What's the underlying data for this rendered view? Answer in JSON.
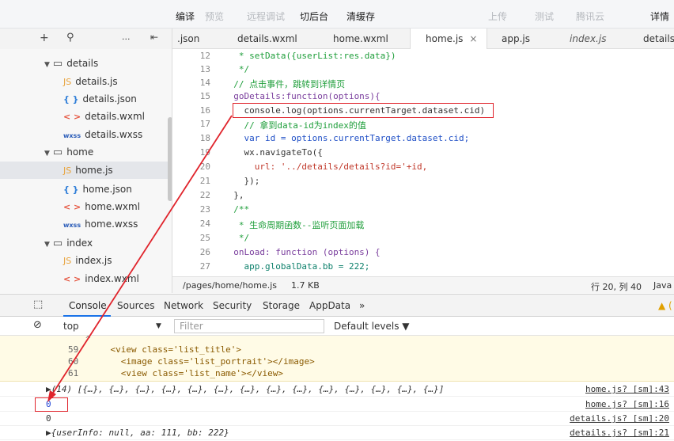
{
  "toolbar": {
    "compile": "编译",
    "preview": "预览",
    "remote_debug": "远程调试",
    "background": "切后台",
    "clear_cache": "清缓存",
    "upload": "上传",
    "test": "测试",
    "tencent_cloud": "腾讯云",
    "details": "详情"
  },
  "tabs": [
    {
      "label": ".json"
    },
    {
      "label": "details.wxml"
    },
    {
      "label": "home.wxml"
    },
    {
      "label": "home.js",
      "close": "×"
    },
    {
      "label": "app.js"
    },
    {
      "label": "index.js"
    },
    {
      "label": "details"
    }
  ],
  "side_tools": {
    "plus": "+",
    "search": "⚲",
    "more": "···",
    "collapse": "⇤"
  },
  "tree": [
    {
      "label": "details",
      "type": "folder"
    },
    {
      "label": "details.js",
      "type": "js",
      "badge": "JS"
    },
    {
      "label": "details.json",
      "type": "json",
      "badge": "{ }"
    },
    {
      "label": "details.wxml",
      "type": "wxml",
      "badge": "< >"
    },
    {
      "label": "details.wxss",
      "type": "wxss",
      "badge": "wxss"
    },
    {
      "label": "home",
      "type": "folder"
    },
    {
      "label": "home.js",
      "type": "js",
      "badge": "JS"
    },
    {
      "label": "home.json",
      "type": "json",
      "badge": "{ }"
    },
    {
      "label": "home.wxml",
      "type": "wxml",
      "badge": "< >"
    },
    {
      "label": "home.wxss",
      "type": "wxss",
      "badge": "wxss"
    },
    {
      "label": "index",
      "type": "folder"
    },
    {
      "label": "index.js",
      "type": "js",
      "badge": "JS"
    },
    {
      "label": "index.wxml",
      "type": "wxml",
      "badge": "< >"
    }
  ],
  "editor": {
    "line_numbers": [
      "12",
      "13",
      "14",
      "15",
      "16",
      "17",
      "18",
      "19",
      "20",
      "21",
      "22",
      "23",
      "24",
      "25",
      "26",
      "27"
    ],
    "lines": [
      "   * setData({userList:res.data})",
      "   */",
      "  // 点击事件，跳转到详情页",
      "  goDetails:function(options){",
      "    console.log(options.currentTarget.dataset.cid)",
      "    // 拿到data-id为index的值",
      "    var id = options.currentTarget.dataset.cid;",
      "    wx.navigateTo({",
      "      url: '../details/details?id='+id,",
      "    });",
      "  },",
      "  /**",
      "   * 生命周期函数--监听页面加载",
      "   */",
      "  onLoad: function (options) {",
      "    app.globalData.bb = 222;"
    ]
  },
  "status": {
    "path": "/pages/home/home.js",
    "size": "1.7 KB",
    "cursor": "行 20, 列 40",
    "lang": "Java"
  },
  "devtools": {
    "tabs": [
      "Console",
      "Sources",
      "Network",
      "Security",
      "Storage",
      "AppData",
      "»"
    ],
    "warn_badge": "▲ (",
    "context": "top",
    "filter_placeholder": "Filter",
    "levels": "Default levels ▼"
  },
  "console": {
    "snippet": [
      {
        "num": "59",
        "code": "    <view class='list_title'>"
      },
      {
        "num": "60",
        "code": "      <image class='list_portrait'></image>"
      },
      {
        "num": "61",
        "code": "      <view class='list_name'></view>"
      }
    ],
    "rows": [
      {
        "text": "▶(14) [{…}, {…}, {…}, {…}, {…}, {…}, {…}, {…}, {…}, {…}, {…}, {…}, {…}, {…}]",
        "link": "home.js? [sm]:43"
      },
      {
        "text": "0",
        "link": "home.js? [sm]:16"
      },
      {
        "text": "0",
        "link": "details.js? [sm]:20"
      },
      {
        "text": "▶{userInfo: null, aa: 111, bb: 222}",
        "link": "details.js? [sm]:21"
      }
    ]
  }
}
